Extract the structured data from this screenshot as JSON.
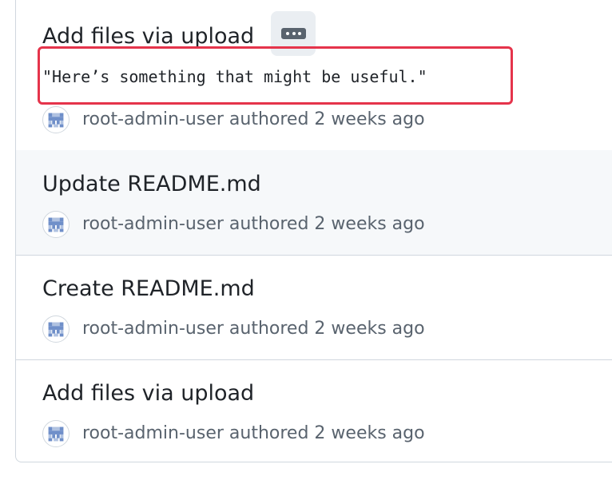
{
  "commits": [
    {
      "title": "Add files via upload",
      "description": "\"Here’s something that might be useful.\"",
      "author": "root-admin-user",
      "action": "authored",
      "time": "2 weeks ago",
      "expanded": true,
      "ellipsis_icon": "ellipsis-icon"
    },
    {
      "title": "Update README.md",
      "author": "root-admin-user",
      "action": "authored",
      "time": "2 weeks ago"
    },
    {
      "title": "Create README.md",
      "author": "root-admin-user",
      "action": "authored",
      "time": "2 weeks ago"
    },
    {
      "title": "Add files via upload",
      "author": "root-admin-user",
      "action": "authored",
      "time": "2 weeks ago"
    }
  ],
  "colors": {
    "highlight_border": "#e5344b",
    "muted_text": "#59636e",
    "hover_row": "#f6f8fa",
    "avatar_identicon": "#6f8fc9"
  }
}
